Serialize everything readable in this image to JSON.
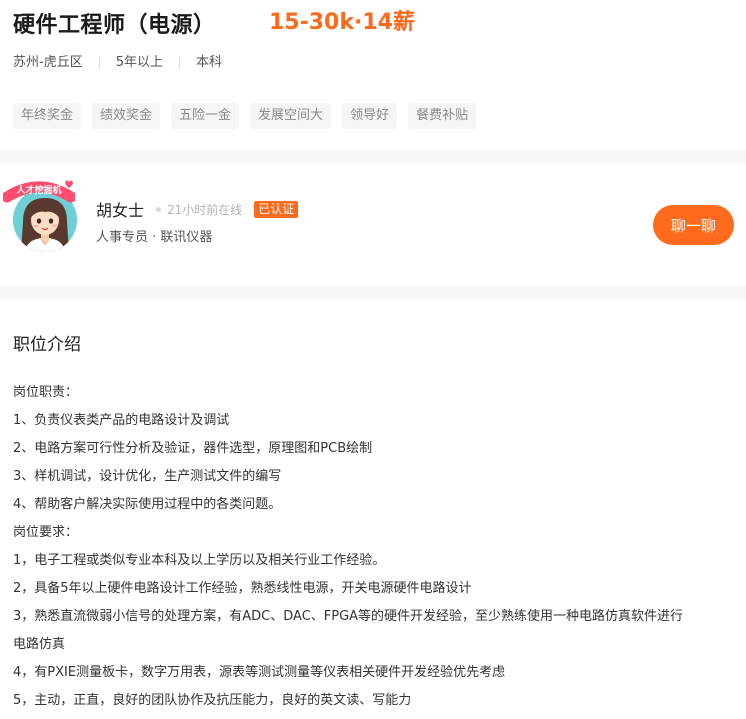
{
  "job": {
    "title": "硬件工程师（电源）",
    "salary": "15-30k·14薪",
    "meta": [
      "苏州-虎丘区",
      "5年以上",
      "本科"
    ],
    "tags": [
      "年终奖金",
      "绩效奖金",
      "五险一金",
      "发展空间大",
      "领导好",
      "餐费补贴"
    ]
  },
  "recruiter": {
    "name": "胡女士",
    "online_status": "21小时前在线",
    "verified": "已认证",
    "role": "人事专员 · 联讯仪器",
    "avatar_badge": "人才挖掘机",
    "chat_label": "聊一聊"
  },
  "description": {
    "section_title": "职位介绍",
    "lines": [
      "岗位职责：",
      "1、负责仪表类产品的电路设计及调试",
      "2、电路方案可行性分析及验证，器件选型，原理图和PCB绘制",
      "3、样机调试，设计优化，生产测试文件的编写",
      "4、帮助客户解决实际使用过程中的各类问题。",
      "岗位要求：",
      "1，电子工程或类似专业本科及以上学历以及相关行业工作经验。",
      "2，具备5年以上硬件电路设计工作经验，熟悉线性电源，开关电源硬件电路设计",
      "3，熟悉直流微弱小信号的处理方案，有ADC、DAC、FPGA等的硬件开发经验，至少熟练使用一种电路仿真软件进行",
      "电路仿真",
      "4，有PXIE测量板卡，数字万用表，源表等测试测量等仪表相关硬件开发经验优先考虑",
      "5，主动，正直，良好的团队协作及抗压能力，良好的英文读、写能力"
    ]
  },
  "colors": {
    "accent": "#ff6a1c",
    "salary": "#fe6a1c",
    "tag_bg": "#f5f5f5",
    "tag_text": "#8a8a8a"
  },
  "icons": {
    "avatar": "female-avatar-icon",
    "online": "online-dot-icon"
  }
}
